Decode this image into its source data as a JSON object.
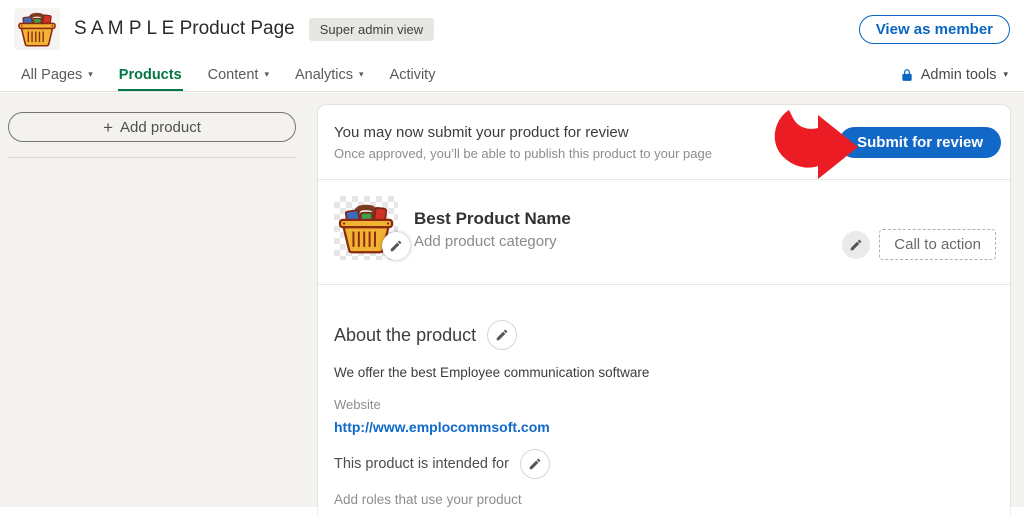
{
  "icons": {
    "caret": "▾",
    "plus": "+"
  },
  "header": {
    "title": "S A M P L E Product Page",
    "badge": "Super admin view",
    "view_as_member_button": "View as member"
  },
  "nav": {
    "items": [
      {
        "label": "All Pages"
      },
      {
        "label": "Products"
      },
      {
        "label": "Content"
      },
      {
        "label": "Analytics"
      },
      {
        "label": "Activity"
      }
    ],
    "active_item": "Products",
    "admin_tools_label": "Admin tools"
  },
  "sidebar": {
    "add_product_button": "Add product"
  },
  "review_banner": {
    "title": "You may now submit your product for review",
    "subtitle": "Once approved, you’ll be able to publish this product to your page",
    "submit_button": "Submit for review"
  },
  "product": {
    "name": "Best Product Name",
    "category_placeholder": "Add product category",
    "call_to_action_button": "Call to action"
  },
  "about": {
    "heading": "About the product",
    "description": "We offer the best Employee communication software",
    "website_label": "Website",
    "website_url": "http://www.emplocommsoft.com",
    "intended_for_label": "This product is intended for",
    "roles_placeholder": "Add roles that use your product"
  },
  "colors": {
    "accent_blue": "#0a66c2",
    "submit_button_blue": "#1268c7",
    "nav_active_green": "#057642",
    "arrow_red": "#ec1c24",
    "page_background": "#f3f2ef"
  }
}
